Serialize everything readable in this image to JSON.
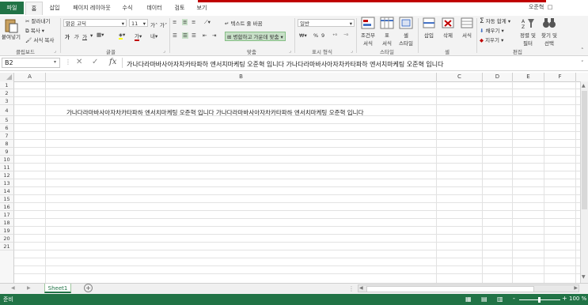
{
  "tabs": {
    "file": "파일",
    "items": [
      "홈",
      "삽입",
      "페이지 레이아웃",
      "수식",
      "데이터",
      "검토",
      "보기"
    ],
    "active": "홈"
  },
  "user": "오준혁",
  "ribbon": {
    "clipboard": {
      "paste": "붙여넣기",
      "cut": "잘라내기",
      "copy": "복사",
      "format_painter": "서식 복사",
      "label": "클립보드"
    },
    "font": {
      "name": "맑은 고딕",
      "size": "11",
      "bold": "가",
      "italic": "가",
      "underline": "가",
      "grow": "가",
      "shrink": "가",
      "label": "글꼴"
    },
    "alignment": {
      "wrap": "텍스트 줄 바꿈",
      "merge": "병합하고 가운데 맞춤",
      "label": "맞춤"
    },
    "number": {
      "format": "일반",
      "percent": "%",
      "comma": "9",
      "label": "표시 형식"
    },
    "styles": {
      "conditional": "조건부",
      "conditional2": "서식",
      "table": "표",
      "table2": "서식",
      "cell": "셀",
      "cell2": "스타일",
      "label": "스타일"
    },
    "cells": {
      "insert": "삽입",
      "delete": "삭제",
      "format": "서식",
      "label": "셀"
    },
    "editing": {
      "autosum": "자동 합계",
      "fill": "채우기",
      "clear": "지우기",
      "sort": "정렬 및",
      "sort2": "필터",
      "find": "찾기 및",
      "find2": "선택",
      "label": "편집"
    }
  },
  "formula_bar": {
    "name_box": "B2",
    "fx": "fx",
    "content": "가나다라마바사아자차카타파하 엔서치마케팅 오준혁 입니다 가나다라마바사아자차카타파하 엔서치마케팅 오준혁 입니다"
  },
  "columns": [
    "A",
    "B",
    "C",
    "D",
    "E",
    "F"
  ],
  "rows": [
    "1",
    "2",
    "3",
    "4",
    "5",
    "6",
    "7",
    "8",
    "9",
    "10",
    "11",
    "12",
    "13",
    "14",
    "15",
    "16",
    "17",
    "18",
    "19",
    "20",
    "21"
  ],
  "cell_b4": "가나다라마바사아자차카타파하 엔서치마케팅 오준혁 입니다 가나다라마바사아자차카타파하 엔서치마케팅 오준혁 입니다",
  "sheet_tab": "Sheet1",
  "add_sheet": "+",
  "status": {
    "ready": "준비",
    "zoom": "100 %",
    "zoom_minus": "-",
    "zoom_plus": "+"
  }
}
